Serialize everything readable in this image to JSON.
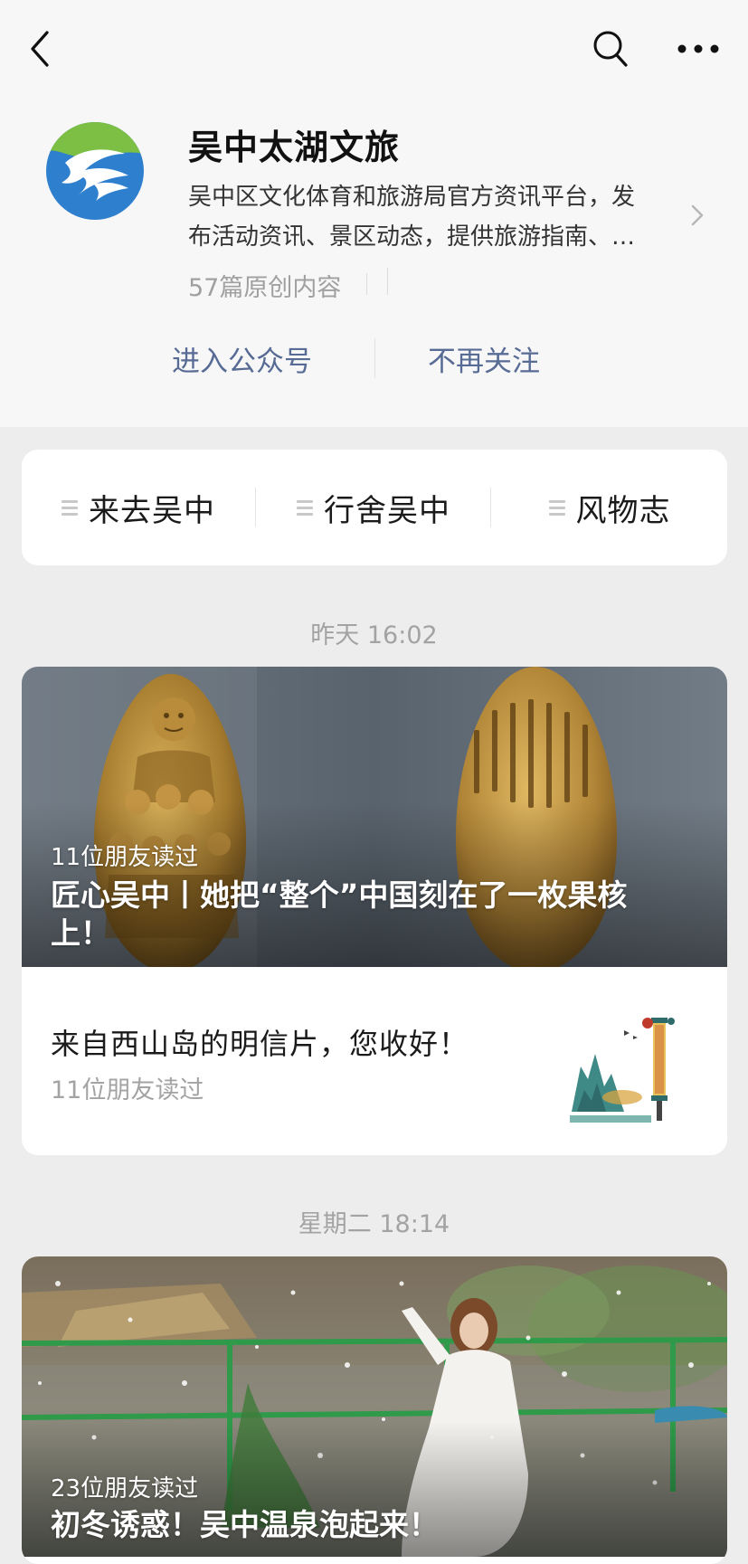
{
  "account": {
    "name": "吴中太湖文旅",
    "description_line1": "吴中区文化体育和旅游局官方资讯平台，发",
    "description_line2": "布活动资讯、景区动态，提供旅游指南、…",
    "original_count": "57篇原创内容"
  },
  "actions": {
    "enter": "进入公众号",
    "unfollow": "不再关注"
  },
  "menu": [
    {
      "label": "来去吴中"
    },
    {
      "label": "行舍吴中"
    },
    {
      "label": "风物志"
    }
  ],
  "feed": [
    {
      "time": "昨天 16:02",
      "main": {
        "readers": "11位朋友读过",
        "title_line1": "匠心吴中丨她把“整个”中国刻在了一枚果核",
        "title_line2": "上！"
      },
      "sub": {
        "title": "来自西山岛的明信片，您收好！",
        "readers": "11位朋友读过"
      }
    },
    {
      "time": "星期二 18:14",
      "main": {
        "readers": "23位朋友读过",
        "title_line1": "初冬诱惑！吴中温泉泡起来！"
      }
    }
  ]
}
